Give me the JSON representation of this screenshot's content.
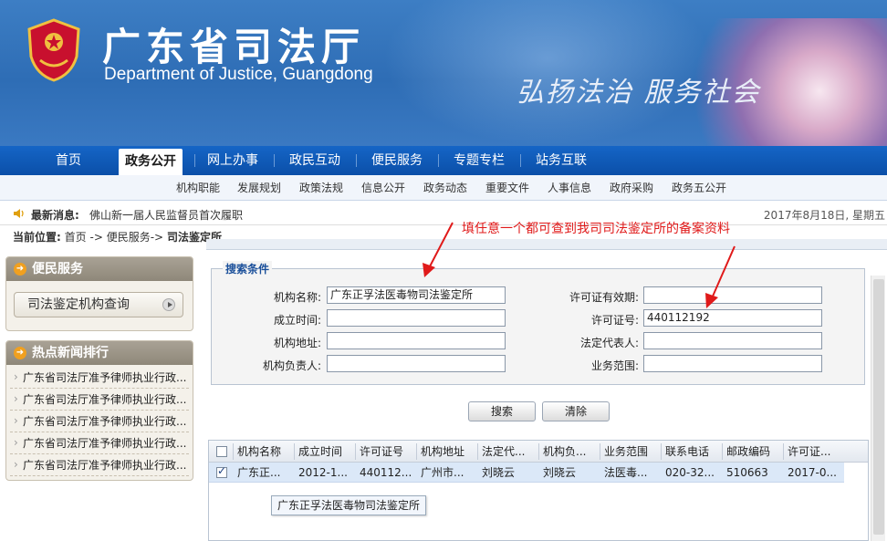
{
  "header": {
    "title_cn": "广东省司法厅",
    "title_en": "Department of Justice, Guangdong",
    "slogan": "弘扬法治 服务社会"
  },
  "nav": {
    "main": [
      "首页",
      "政务公开",
      "网上办事",
      "政民互动",
      "便民服务",
      "专题专栏",
      "站务互联"
    ],
    "active": "政务公开",
    "sub": [
      "机构职能",
      "发展规划",
      "政策法规",
      "信息公开",
      "政务动态",
      "重要文件",
      "人事信息",
      "政府采购",
      "政务五公开"
    ]
  },
  "ticker": {
    "label": "最新消息:",
    "text": "佛山新一届人民监督员首次履职",
    "date": "2017年8月18日, 星期五"
  },
  "breadcrumb": {
    "label": "当前位置:",
    "home": "首页",
    "sep1": "->",
    "level1": "便民服务",
    "sep2": "->",
    "current": "司法鉴定所"
  },
  "sidebar": {
    "service_title": "便民服务",
    "service_button": "司法鉴定机构查询",
    "hot_title": "热点新闻排行",
    "hot_items": [
      "广东省司法厅准予律师执业行政...",
      "广东省司法厅准予律师执业行政...",
      "广东省司法厅准予律师执业行政...",
      "广东省司法厅准予律师执业行政...",
      "广东省司法厅准予律师执业行政..."
    ]
  },
  "search": {
    "legend": "搜索条件",
    "fields_left": [
      {
        "label": "机构名称:",
        "value": "广东正孚法医毒物司法鉴定所"
      },
      {
        "label": "成立时间:",
        "value": ""
      },
      {
        "label": "机构地址:",
        "value": ""
      },
      {
        "label": "机构负责人:",
        "value": ""
      }
    ],
    "fields_right": [
      {
        "label": "许可证有效期:",
        "value": ""
      },
      {
        "label": "许可证号:",
        "value": "440112192"
      },
      {
        "label": "法定代表人:",
        "value": ""
      },
      {
        "label": "业务范围:",
        "value": ""
      }
    ],
    "search_btn": "搜索",
    "clear_btn": "清除"
  },
  "results": {
    "columns": [
      "机构名称",
      "成立时间",
      "许可证号",
      "机构地址",
      "法定代...",
      "机构负...",
      "业务范围",
      "联系电话",
      "邮政编码",
      "许可证..."
    ],
    "rows": [
      [
        "广东正...",
        "2012-1...",
        "440112...",
        "广州市...",
        "刘晓云",
        "刘晓云",
        "法医毒...",
        "020-32...",
        "510663",
        "2017-0..."
      ]
    ],
    "tooltip": "广东正孚法医毒物司法鉴定所"
  },
  "annotation": "填任意一个都可查到我司司法鉴定所的备案资料",
  "colors": {
    "nav_blue": "#0b4fa8",
    "annotation_red": "#e01a1a",
    "legend_blue": "#1a4f9a"
  }
}
